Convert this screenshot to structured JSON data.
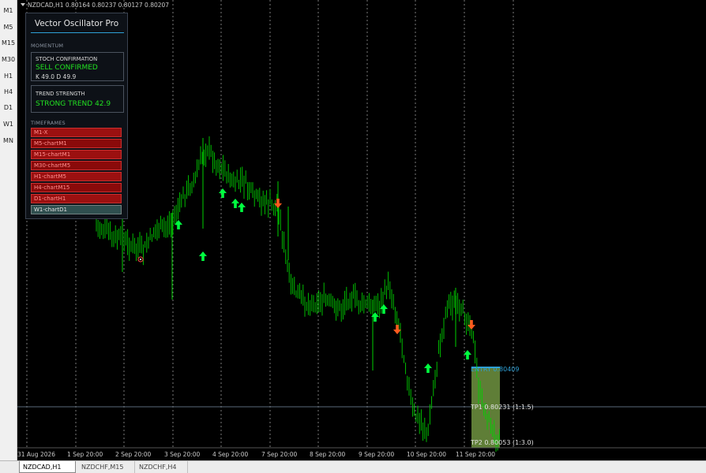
{
  "timeframes": [
    "M1",
    "M5",
    "M15",
    "M30",
    "H1",
    "H4",
    "D1",
    "W1",
    "MN"
  ],
  "symbol_info": "NZDCAD,H1  0.80164 0.80237 0.80127 0.80207",
  "panel": {
    "title": "Vector Oscillator Pro",
    "momentum_label": "MOMENTUM",
    "stoch": {
      "heading": "STOCH CONFIRMATION",
      "signal": "SELL   CONFIRMED",
      "values": "K 49.0   D 49.9"
    },
    "trend": {
      "heading": "TREND STRENGTH",
      "value": "STRONG TREND   42.9"
    },
    "timeframes_label": "TIMEFRAMES",
    "tf_rows": [
      "M1-X",
      "M5-chartM1",
      "M15-chartM1",
      "M30-chartM5",
      "H1-chartM5",
      "H4-chartM15",
      "D1-chartH1",
      "W1-chartD1"
    ]
  },
  "levels": {
    "entry": "ENTRY 0.80409",
    "tp1": "TP1 0.80231 (1:1.5)",
    "tp2": "TP2 0.80053 (1:3.0)"
  },
  "date_labels": [
    "31 Aug 2026",
    "1 Sep 20:00",
    "2 Sep 20:00",
    "3 Sep 20:00",
    "4 Sep 20:00",
    "7 Sep 20:00",
    "8 Sep 20:00",
    "9 Sep 20:00",
    "10 Sep 20:00",
    "11 Sep 20:00"
  ],
  "tabs": [
    "NZDCAD,H1",
    "NZDCHF,M15",
    "NZDCHF,H4"
  ],
  "colors": {
    "candle": "#00e000",
    "buy_arrow": "#00ff40",
    "sell_arrow": "#ff5a1e",
    "entry": "#2ea0d6",
    "zone": "#7fa84a"
  }
}
